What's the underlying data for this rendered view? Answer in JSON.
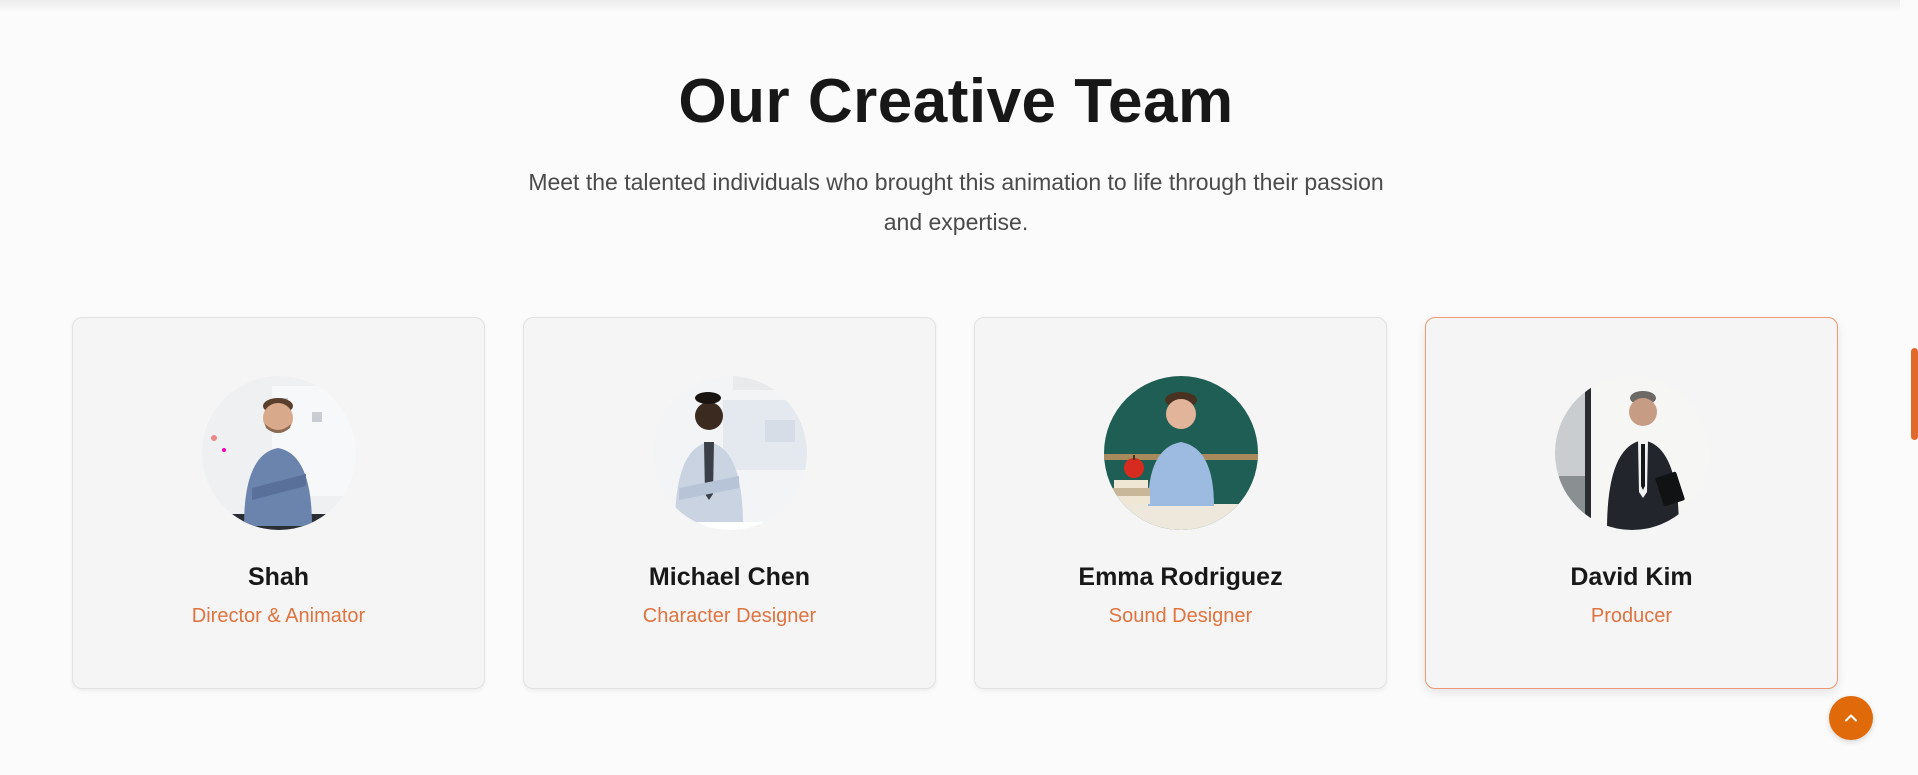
{
  "section": {
    "title": "Our Creative Team",
    "subtitle": "Meet the talented individuals who brought this animation to life through their passion and expertise."
  },
  "team": [
    {
      "name": "Shah",
      "role": "Director & Animator",
      "photo_icon": "man-arms-crossed-photo"
    },
    {
      "name": "Michael Chen",
      "role": "Character Designer",
      "photo_icon": "man-tie-office-photo"
    },
    {
      "name": "Emma Rodriguez",
      "role": "Sound Designer",
      "photo_icon": "teacher-chalkboard-photo"
    },
    {
      "name": "David Kim",
      "role": "Producer",
      "photo_icon": "businessman-suit-photo"
    }
  ],
  "colors": {
    "accent": "#e0733f",
    "button": "#e06a0a",
    "active_border": "#ef9a74"
  },
  "back_to_top_icon": "chevron-up-icon"
}
